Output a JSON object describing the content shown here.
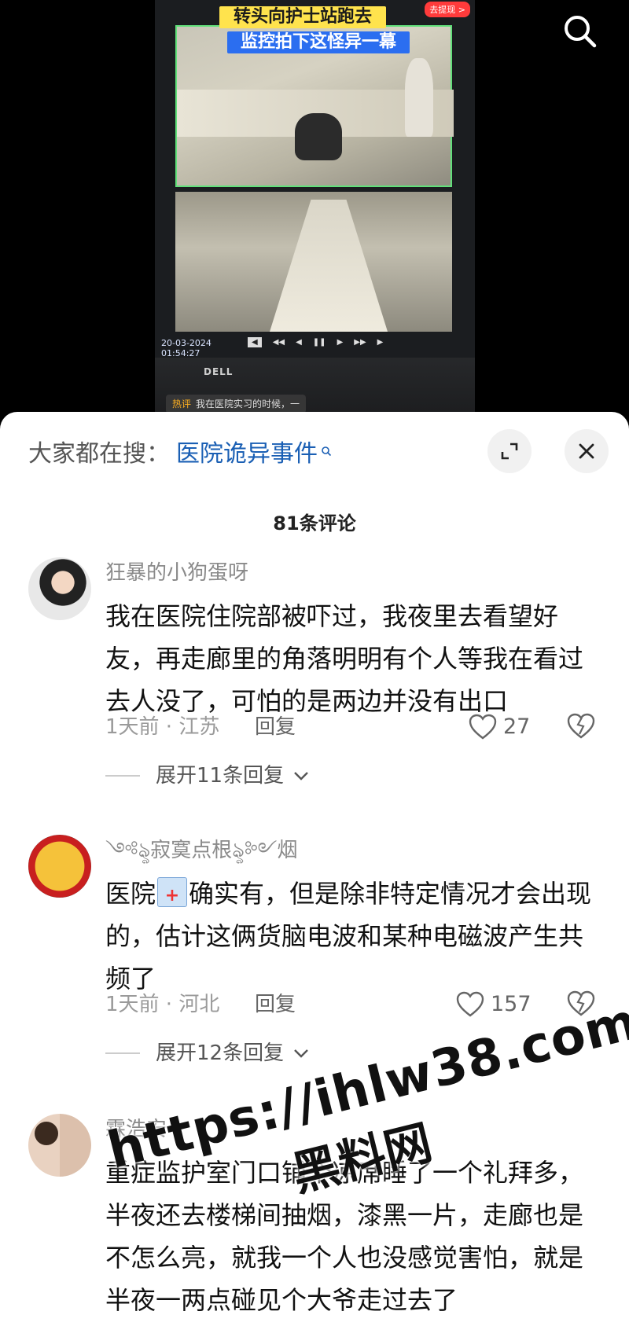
{
  "video": {
    "caption_line1": "转头向护士站跑去",
    "caption_line2": "监控拍下这怪异一幕",
    "top_right_pill": "去提现 >",
    "timestamp_date": "20-03-2024",
    "timestamp_time": "01:54:27",
    "monitor_brand": "DELL",
    "hot_label": "热评",
    "hot_text": "我在医院实习的时候，一"
  },
  "sheet": {
    "search_prefix": "大家都在搜：",
    "search_query": "医院诡异事件",
    "comment_count": "81条评论"
  },
  "comments": [
    {
      "username": "狂暴的小狗蛋呀",
      "text": "我在医院住院部被吓过，我夜里去看望好友，再走廊里的角落明明有个人等我在看过去人没了，可怕的是两边并没有出口",
      "meta": "1天前 · 江苏",
      "reply_label": "回复",
      "likes": "27",
      "expand_label": "展开11条回复"
    },
    {
      "username": "༺ৡ寂寞点根ৡ༻烟",
      "text_before": "医院",
      "text_after": "确实有，但是除非特定情况才会出现的，估计这俩货脑电波和某种电磁波产生共频了",
      "meta": "1天前 · 河北",
      "reply_label": "回复",
      "likes": "157",
      "expand_label": "展开12条回复"
    },
    {
      "username": "霖浩安",
      "text": "重症监护室门口铺个凉席睡了一个礼拜多，半夜还去楼梯间抽烟，漆黑一片，走廊也是不怎么亮，就我一个人也没感觉害怕，就是半夜一两点碰见个大爷走过去了"
    }
  ],
  "watermark": {
    "url": "https://ihlw38.com",
    "name": "黑料网"
  },
  "icons": {
    "search": "search-icon",
    "expand": "expand-icon",
    "close": "close-icon",
    "heart": "heart-icon",
    "broken_heart": "broken-heart-icon",
    "chevron": "chevron-down-icon"
  }
}
